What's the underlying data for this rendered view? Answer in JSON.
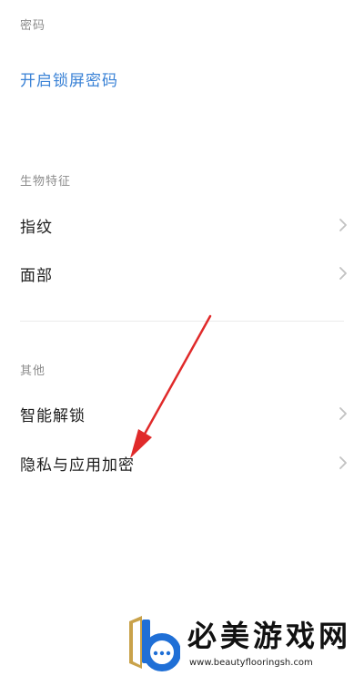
{
  "sections": {
    "password": {
      "header": "密码",
      "link": "开启锁屏密码"
    },
    "biometrics": {
      "header": "生物特征",
      "items": [
        {
          "label": "指纹"
        },
        {
          "label": "面部"
        }
      ]
    },
    "other": {
      "header": "其他",
      "items": [
        {
          "label": "智能解锁"
        },
        {
          "label": "隐私与应用加密"
        }
      ]
    }
  },
  "watermark": {
    "title": "必美游戏网",
    "url": "www.beautyflooringsh.com"
  },
  "colors": {
    "accent": "#3a82d6",
    "section_header": "#8c8c8c",
    "arrow": "#e02a2a",
    "logo_blue": "#1f6fd6"
  }
}
